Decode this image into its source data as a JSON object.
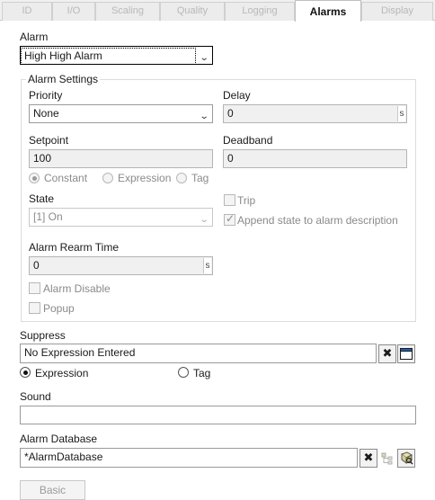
{
  "tabs": [
    "ID",
    "I/O",
    "Scaling",
    "Quality",
    "Logging",
    "Alarms",
    "Display"
  ],
  "active_tab": "Alarms",
  "alarm": {
    "label": "Alarm",
    "value": "High High Alarm"
  },
  "settings": {
    "title": "Alarm Settings",
    "priority": {
      "label": "Priority",
      "value": "None"
    },
    "delay": {
      "label": "Delay",
      "value": "0",
      "unit": "s"
    },
    "setpoint": {
      "label": "Setpoint",
      "value": "100"
    },
    "deadband": {
      "label": "Deadband",
      "value": "0"
    },
    "setpoint_mode": {
      "constant": "Constant",
      "expression": "Expression",
      "tag": "Tag",
      "selected": "Constant"
    },
    "state": {
      "label": "State",
      "value": "[1] On"
    },
    "trip": {
      "label": "Trip",
      "checked": false
    },
    "append": {
      "label": "Append state to alarm description",
      "checked": true
    },
    "rearm": {
      "label": "Alarm Rearm Time",
      "value": "0",
      "unit": "s"
    },
    "alarm_disable": {
      "label": "Alarm Disable",
      "checked": false
    },
    "popup": {
      "label": "Popup",
      "checked": false
    }
  },
  "suppress": {
    "label": "Suppress",
    "value": "No Expression Entered",
    "mode": {
      "expression": "Expression",
      "tag": "Tag",
      "selected": "Expression"
    }
  },
  "sound": {
    "label": "Sound",
    "value": ""
  },
  "database": {
    "label": "Alarm Database",
    "value": "*AlarmDatabase"
  },
  "basic_button": "Basic"
}
